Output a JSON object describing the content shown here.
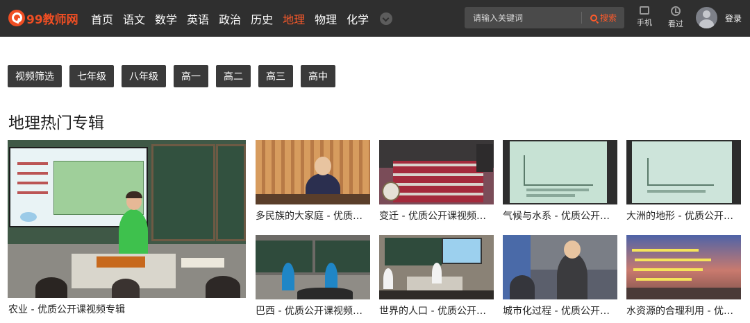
{
  "header": {
    "logo_text": "99教师网",
    "nav": [
      {
        "label": "首页",
        "active": false
      },
      {
        "label": "语文",
        "active": false
      },
      {
        "label": "数学",
        "active": false
      },
      {
        "label": "英语",
        "active": false
      },
      {
        "label": "政治",
        "active": false
      },
      {
        "label": "历史",
        "active": false
      },
      {
        "label": "地理",
        "active": true
      },
      {
        "label": "物理",
        "active": false
      },
      {
        "label": "化学",
        "active": false
      }
    ],
    "search": {
      "placeholder": "请输入关键词",
      "button_label": "搜索"
    },
    "tools": {
      "phone": "手机",
      "history": "看过"
    },
    "login": "登录"
  },
  "filters": [
    "视频筛选",
    "七年级",
    "八年级",
    "高一",
    "高二",
    "高三",
    "高中"
  ],
  "section_title": "地理热门专辑",
  "featured": {
    "caption": "农业 - 优质公开课视频专辑"
  },
  "cards": [
    {
      "caption": "多民族的大家庭 - 优质公开课视频专辑"
    },
    {
      "caption": "变迁 - 优质公开课视频专辑"
    },
    {
      "caption": "气候与水系 - 优质公开课视频专辑"
    },
    {
      "caption": "大洲的地形 - 优质公开课视频专辑"
    },
    {
      "caption": "巴西 - 优质公开课视频专辑"
    },
    {
      "caption": "世界的人口 - 优质公开课视频专辑"
    },
    {
      "caption": "城市化过程 - 优质公开课视频专辑"
    },
    {
      "caption": "水资源的合理利用 - 优质公开课视频专辑"
    }
  ],
  "colors": {
    "nav_bg": "#2f2f2f",
    "accent": "#ff5a2a",
    "button_bg": "#3a3a3a"
  }
}
